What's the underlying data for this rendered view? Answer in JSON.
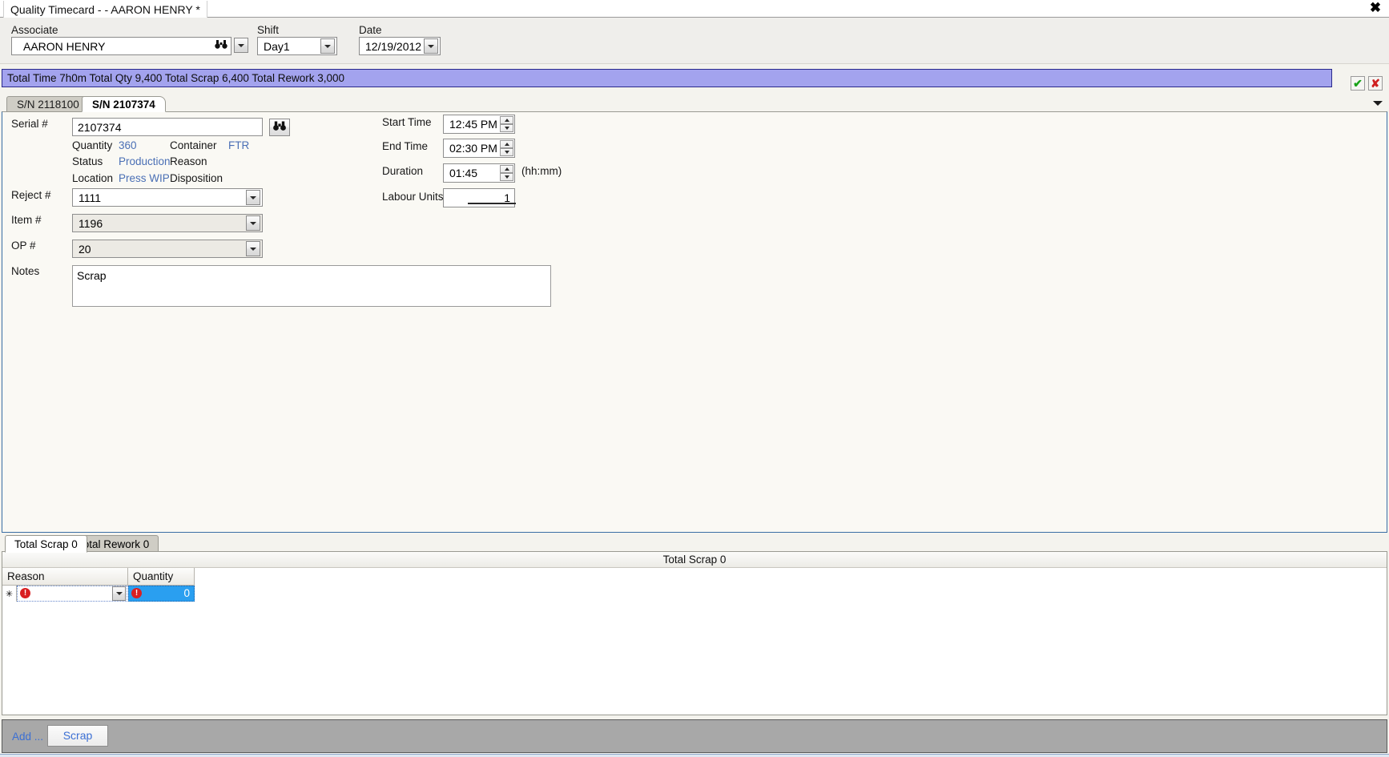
{
  "window": {
    "document_tab_title": "Quality Timecard - - AARON HENRY *",
    "close_label": "✖"
  },
  "filters": {
    "associate": {
      "label": "Associate",
      "value": "AARON HENRY",
      "search_icon": "🔭",
      "dropdown_icon": "chevron-down-icon"
    },
    "shift": {
      "label": "Shift",
      "value": "Day1"
    },
    "date": {
      "label": "Date",
      "value": "12/19/2012"
    }
  },
  "totals_banner": {
    "text": "Total Time 7h0m  Total Qty 9,400  Total Scrap 6,400 Total Rework 3,000",
    "accent_color": "#a3a3ee",
    "border_color": "#2a2a8c"
  },
  "confirm": {
    "ok_label": "✔",
    "cancel_label": "✘",
    "ok_color": "#18a218",
    "cancel_color": "#cf2020"
  },
  "serial_tabs": [
    {
      "label": "S/N 2118100",
      "active": false
    },
    {
      "label": "S/N 2107374",
      "active": true
    }
  ],
  "detail_form": {
    "serial": {
      "label": "Serial #",
      "value": "2107374",
      "lookup_icon": "🔭"
    },
    "info": [
      {
        "key": "Quantity",
        "value": "360",
        "key2": "Container",
        "value2": "FTR"
      },
      {
        "key": "Status",
        "value": "Production",
        "key2": "Reason",
        "value2": ""
      },
      {
        "key": "Location",
        "value": "Press WIP",
        "key2": "Disposition",
        "value2": ""
      }
    ],
    "reject": {
      "label": "Reject #",
      "value": "1111"
    },
    "item": {
      "label": "Item #",
      "value": "1196"
    },
    "op": {
      "label": "OP #",
      "value": "20"
    },
    "notes": {
      "label": "Notes",
      "value": "Scrap"
    },
    "start_time": {
      "label": "Start Time",
      "value": "12:45 PM"
    },
    "end_time": {
      "label": "End Time",
      "value": "02:30 PM"
    },
    "duration": {
      "label": "Duration",
      "value": "01:45",
      "hint": "(hh:mm)"
    },
    "labour_units": {
      "label": "Labour Units",
      "value": "1"
    }
  },
  "bottom_tabs": [
    {
      "label": "Total Scrap 0",
      "active": true
    },
    {
      "label": "Total Rework 0",
      "active": false
    }
  ],
  "grid": {
    "caption": "Total Scrap 0",
    "columns": [
      "Reason",
      "Quantity"
    ],
    "rows": [
      {
        "row_marker": "✳",
        "row_error": "!",
        "reason_error": "!",
        "reason_value": "",
        "quantity_error": "!",
        "quantity_value": "0"
      }
    ]
  },
  "toolbar": {
    "add_label": "Add ...",
    "scrap_label": "Scrap"
  }
}
